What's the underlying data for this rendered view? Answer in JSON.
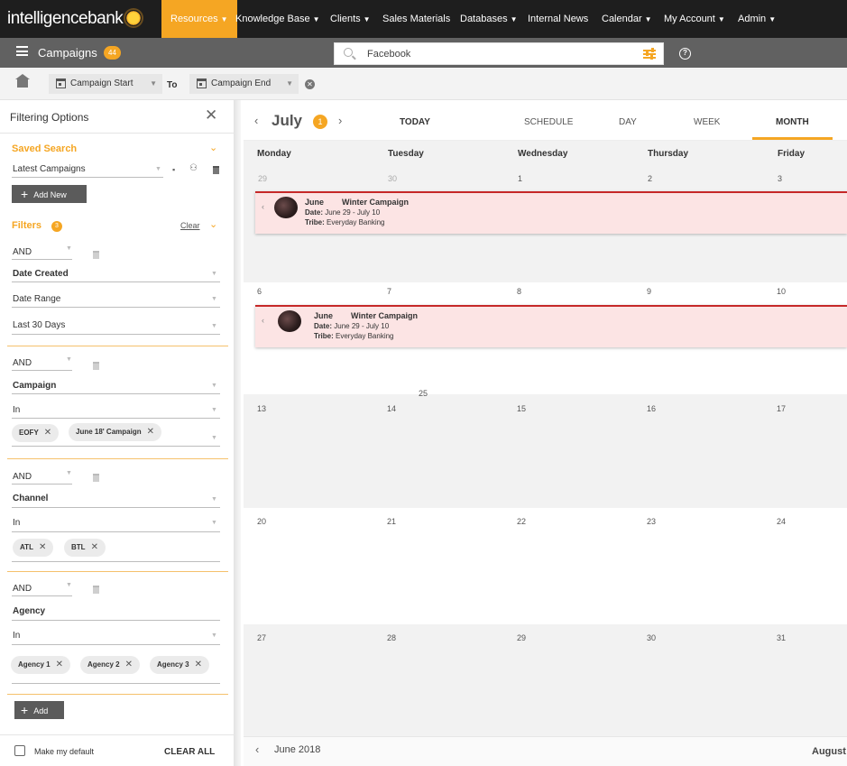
{
  "app": {
    "logo_text": "intelligencebank"
  },
  "nav": {
    "items": [
      {
        "label": "Resources",
        "caret": true
      },
      {
        "label": "Knowledge Base",
        "caret": true
      },
      {
        "label": "Clients",
        "caret": true
      },
      {
        "label": "Sales Materials",
        "caret": false
      },
      {
        "label": "Databases",
        "caret": true
      },
      {
        "label": "Internal News",
        "caret": false
      },
      {
        "label": "Calendar",
        "caret": true
      },
      {
        "label": "My Account",
        "caret": true
      },
      {
        "label": "Admin",
        "caret": true
      }
    ],
    "active_color": "#f5a623"
  },
  "campaigns_bar": {
    "title": "Campaigns",
    "badge": "44",
    "search_value": "Facebook"
  },
  "date_bar": {
    "start_label": "Campaign Start",
    "to_label": "To",
    "end_label": "Campaign End"
  },
  "sidebar": {
    "title": "Filtering Options",
    "saved_search": {
      "heading": "Saved Search",
      "selected": "Latest Campaigns",
      "add_new_label": "Add New"
    },
    "filters": {
      "heading": "Filters",
      "badge": "3",
      "clear_label": "Clear",
      "groups": [
        {
          "operator": "AND",
          "field": "Date Created",
          "condition": "Date Range",
          "value": "Last 30 Days",
          "chips": []
        },
        {
          "operator": "AND",
          "field": "Campaign",
          "condition": "In",
          "value": "",
          "chips": [
            "EOFY",
            "June 18' Campaign"
          ]
        },
        {
          "operator": "AND",
          "field": "Channel",
          "condition": "In",
          "value": "",
          "chips": [
            "ATL",
            "BTL"
          ]
        },
        {
          "operator": "AND",
          "field": "Agency",
          "condition": "In",
          "value": "",
          "chips": [
            "Agency 1",
            "Agency 2",
            "Agency 3"
          ]
        }
      ],
      "add_label": "Add"
    },
    "footer": {
      "default_label": "Make my default",
      "clear_all_label": "CLEAR ALL"
    }
  },
  "calendar": {
    "month": "July",
    "month_badge": "1",
    "tabs": [
      "TODAY",
      "SCHEDULE",
      "DAY",
      "WEEK",
      "MONTH"
    ],
    "active_tab": "MONTH",
    "day_names": [
      "Monday",
      "Tuesday",
      "Wednesday",
      "Thursday",
      "Friday"
    ],
    "weeks": [
      [
        "29",
        "30",
        "1",
        "2",
        "3"
      ],
      [
        "6",
        "7",
        "8",
        "9",
        "10"
      ],
      [
        "13",
        "14",
        "15",
        "16",
        "17"
      ],
      [
        "20",
        "21",
        "22",
        "23",
        "24"
      ],
      [
        "27",
        "28",
        "29",
        "30",
        "31"
      ]
    ],
    "stray_number": "25",
    "events": [
      {
        "name_part1": "June",
        "name_part2": "Winter Campaign",
        "date_label": "Date:",
        "date": "June 29 - July 10",
        "tribe_label": "Tribe:",
        "tribe": "Everyday Banking"
      },
      {
        "name_part1": "June",
        "name_part2": "Winter Campaign",
        "date_label": "Date:",
        "date": "June 29 - July 10",
        "tribe_label": "Tribe:",
        "tribe": "Everyday Banking"
      }
    ],
    "event_color": "#c62828",
    "footer_prev": "June 2018",
    "footer_next": "August"
  },
  "icons": [
    "hamburger-icon",
    "search-icon",
    "filter-settings-icon",
    "help-icon",
    "home-icon",
    "calendar-icon",
    "clear-icon",
    "close-icon",
    "chevron-down-icon",
    "save-icon",
    "share-icon",
    "trash-icon",
    "plus-icon",
    "chevron-left-icon",
    "chevron-right-icon",
    "checkbox-icon"
  ]
}
